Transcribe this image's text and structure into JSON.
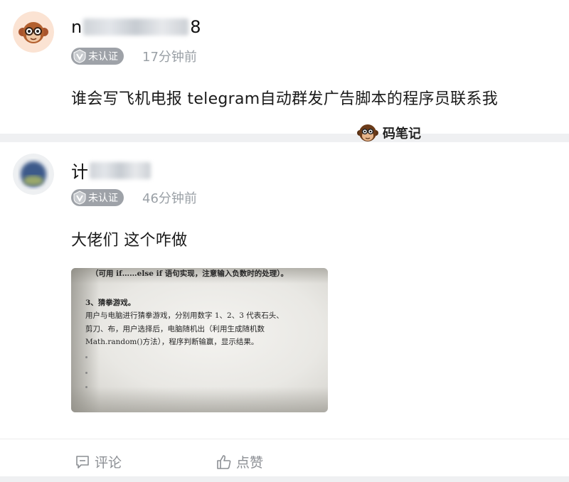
{
  "posts": [
    {
      "user": {
        "name_prefix": "n",
        "name_suffix": "8",
        "badge_label": "未认证"
      },
      "time": "17分钟前",
      "content": "谁会写飞机电报 telegram自动群发广告脚本的程序员联系我"
    },
    {
      "user": {
        "name_prefix": "计",
        "name_suffix": "",
        "badge_label": "未认证"
      },
      "time": "46分钟前",
      "content": "大佬们  这个咋做",
      "photo": {
        "lines": [
          "（可用 if……else if 语句实现，注意输入负数时的处理）。",
          "3、猜拳游戏。",
          "用户与电脑进行猜拳游戏，分别用数字 1、2、3 代表石头、",
          "剪刀、布，用户选择后，电脑随机出（利用生成随机数",
          "Math.random()方法），程序判断输赢，显示结果。"
        ]
      }
    }
  ],
  "watermark": {
    "label": "码笔记"
  },
  "actions": {
    "comment_label": "评论",
    "like_label": "点赞"
  },
  "colors": {
    "badge_bg": "#9ea2a8",
    "time_text": "#9aa0a6",
    "divider": "#eff0f2",
    "action_text": "#8c8f94"
  }
}
